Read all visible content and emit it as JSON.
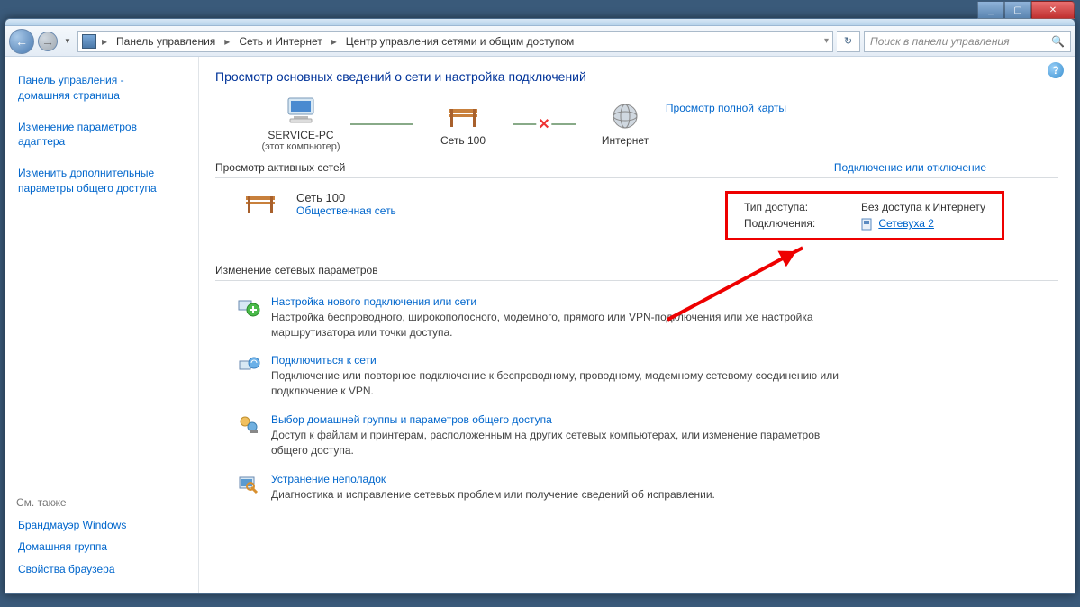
{
  "window_controls": {
    "min": "_",
    "max": "▢",
    "close": "✕"
  },
  "nav": {
    "back": "←",
    "forward": "→",
    "dropdown": "▼"
  },
  "breadcrumb": {
    "seg1": "Панель управления",
    "seg2": "Сеть и Интернет",
    "seg3": "Центр управления сетями и общим доступом"
  },
  "search": {
    "placeholder": "Поиск в панели управления"
  },
  "sidebar": {
    "home1": "Панель управления -",
    "home2": "домашняя страница",
    "link1a": "Изменение параметров",
    "link1b": "адаптера",
    "link2a": "Изменить дополнительные",
    "link2b": "параметры общего доступа",
    "see_also": "См. также",
    "firewall": "Брандмауэр Windows",
    "homegroup": "Домашняя группа",
    "browser": "Свойства браузера"
  },
  "main": {
    "title": "Просмотр основных сведений о сети и настройка подключений",
    "fullmap": "Просмотр полной карты",
    "node_pc": "SERVICE-PC",
    "node_pc_sub": "(этот компьютер)",
    "node_net": "Сеть 100",
    "node_internet": "Интернет",
    "active_header": "Просмотр активных сетей",
    "connect_link": "Подключение или отключение",
    "net_name": "Сеть 100",
    "net_type": "Общественная сеть",
    "access_label": "Тип доступа:",
    "access_value": "Без доступа к Интернету",
    "conn_label": "Подключения:",
    "conn_value": "Сетевуха 2",
    "change_header": "Изменение сетевых параметров",
    "task1_title": "Настройка нового подключения или сети",
    "task1_desc": "Настройка беспроводного, широкополосного, модемного, прямого или VPN-подключения или же настройка маршрутизатора или точки доступа.",
    "task2_title": "Подключиться к сети",
    "task2_desc": "Подключение или повторное подключение к беспроводному, проводному, модемному сетевому соединению или подключение к VPN.",
    "task3_title": "Выбор домашней группы и параметров общего доступа",
    "task3_desc": "Доступ к файлам и принтерам, расположенным на других сетевых компьютерах, или изменение параметров общего доступа.",
    "task4_title": "Устранение неполадок",
    "task4_desc": "Диагностика и исправление сетевых проблем или получение сведений об исправлении."
  }
}
